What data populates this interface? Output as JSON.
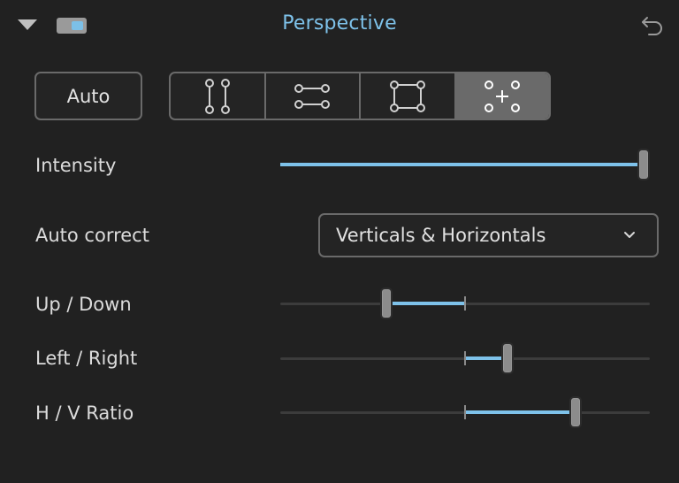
{
  "header": {
    "title": "Perspective"
  },
  "buttons": {
    "auto_label": "Auto"
  },
  "modes": [
    {
      "name": "vertical-guides",
      "active": false
    },
    {
      "name": "horizontal-guides",
      "active": false
    },
    {
      "name": "rectangle",
      "active": false
    },
    {
      "name": "eight-point",
      "active": true
    }
  ],
  "intensity": {
    "label": "Intensity",
    "value": 1.0
  },
  "auto_correct": {
    "label": "Auto correct",
    "selected": "Verticals & Horizontals"
  },
  "up_down": {
    "label": "Up / Down",
    "value": -0.44
  },
  "left_right": {
    "label": "Left / Right",
    "value": 0.24
  },
  "hv_ratio": {
    "label": "H / V Ratio",
    "value": 0.62
  },
  "colors": {
    "accent": "#7ec2ea",
    "background": "#212121",
    "active_mode": "#6a6a6a"
  }
}
